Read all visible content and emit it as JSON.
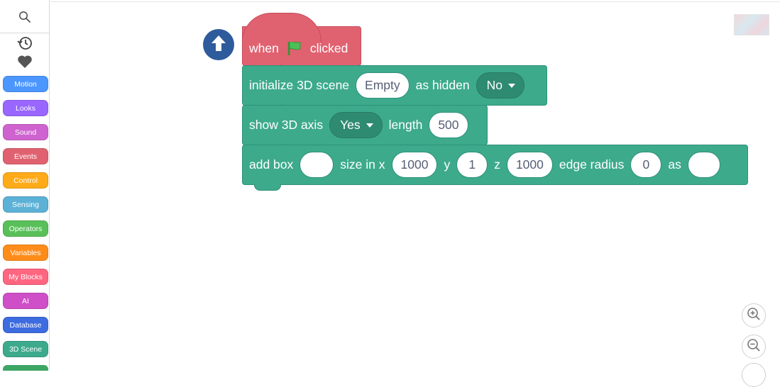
{
  "palette": {
    "categories": [
      {
        "label": "Motion",
        "color": "#4c97ff"
      },
      {
        "label": "Looks",
        "color": "#9966ff"
      },
      {
        "label": "Sound",
        "color": "#cf63cf"
      },
      {
        "label": "Events",
        "color": "#e06270"
      },
      {
        "label": "Control",
        "color": "#ffab19"
      },
      {
        "label": "Sensing",
        "color": "#5cb1d6"
      },
      {
        "label": "Operators",
        "color": "#59c059"
      },
      {
        "label": "Variables",
        "color": "#ff8c1a"
      },
      {
        "label": "My Blocks",
        "color": "#ff6680"
      },
      {
        "label": "AI",
        "color": "#cf4fc8"
      },
      {
        "label": "Database",
        "color": "#3d6be0"
      },
      {
        "label": "3D Scene",
        "color": "#3daa8c"
      }
    ],
    "icons": {
      "search": "search-icon",
      "history": "history-icon",
      "favorites": "heart-icon"
    }
  },
  "script": {
    "hat": {
      "prefix": "when",
      "suffix": "clicked",
      "icon": "green-flag-icon"
    },
    "init": {
      "label": "initialize 3D scene",
      "scene_value": "Empty",
      "hidden_label": "as hidden",
      "hidden_value": "No"
    },
    "axis": {
      "label": "show 3D axis",
      "show_value": "Yes",
      "length_label": "length",
      "length_value": "500"
    },
    "box": {
      "label": "add box",
      "name_value": "",
      "size_label": "size in x",
      "x_value": "1000",
      "y_label": "y",
      "y_value": "1",
      "z_label": "z",
      "z_value": "1000",
      "edge_label": "edge radius",
      "edge_value": "0",
      "as_label": "as",
      "as_value": ""
    }
  },
  "colors": {
    "events": "#e06270",
    "scene3d": "#3daa8c",
    "run_button": "#2e5b9b"
  }
}
